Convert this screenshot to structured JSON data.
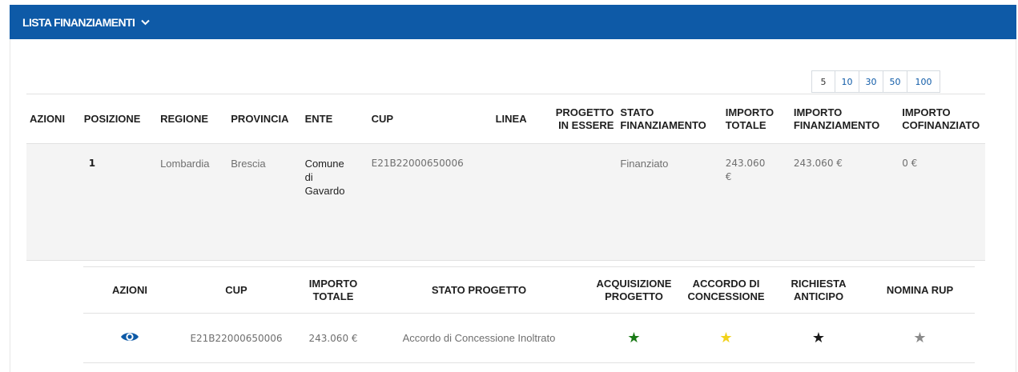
{
  "header": {
    "title": "LISTA FINANZIAMENTI"
  },
  "pager": {
    "sizes": [
      "5",
      "10",
      "30",
      "50",
      "100"
    ],
    "selected": "5"
  },
  "main_table": {
    "columns": {
      "azioni": "AZIONI",
      "posizione": "POSIZIONE",
      "regione": "REGIONE",
      "provincia": "PROVINCIA",
      "ente": "ENTE",
      "cup": "CUP",
      "linea": "LINEA",
      "progetto_in_essere_1": "PROGETTO",
      "progetto_in_essere_2": "IN ESSERE",
      "stato_finanziamento_1": "STATO",
      "stato_finanziamento_2": "FINANZIAMENTO",
      "importo_totale_1": "IMPORTO",
      "importo_totale_2": "TOTALE",
      "importo_finanziamento_1": "IMPORTO",
      "importo_finanziamento_2": "FINANZIAMENTO",
      "importo_cofinanziato_1": "IMPORTO",
      "importo_cofinanziato_2": "COFINANZIATO"
    },
    "rows": [
      {
        "posizione": "1",
        "regione": "Lombardia",
        "provincia": "Brescia",
        "ente_1": "Comune",
        "ente_2": "di",
        "ente_3": "Gavardo",
        "cup": "E21B22000650006",
        "linea": "",
        "progetto_in_essere": "",
        "stato_finanziamento": "Finanziato",
        "importo_totale_1": "243.060",
        "importo_totale_2": "€",
        "importo_finanziamento": "243.060 €",
        "importo_cofinanziato": "0 €"
      }
    ]
  },
  "sub_table": {
    "columns": {
      "azioni": "AZIONI",
      "cup": "CUP",
      "importo_totale_1": "IMPORTO",
      "importo_totale_2": "TOTALE",
      "stato_progetto": "STATO PROGETTO",
      "acquisizione_1": "ACQUISIZIONE",
      "acquisizione_2": "PROGETTO",
      "accordo_1": "ACCORDO DI",
      "accordo_2": "CONCESSIONE",
      "richiesta_1": "RICHIESTA",
      "richiesta_2": "ANTICIPO",
      "nomina_rup": "NOMINA RUP"
    },
    "rows": [
      {
        "action_icon": "eye-icon",
        "cup": "E21B22000650006",
        "importo_totale": "243.060 €",
        "stato_progetto": "Accordo di Concessione Inoltrato",
        "acquisizione_star": "★",
        "accordo_star": "★",
        "richiesta_star": "★",
        "nomina_star": "★"
      }
    ]
  },
  "colors": {
    "brand": "#0e5aa7",
    "star_green": "#1a7a16",
    "star_yellow": "#f2d21b",
    "star_black": "#1a1a1a",
    "star_gray": "#8a8a8a"
  }
}
